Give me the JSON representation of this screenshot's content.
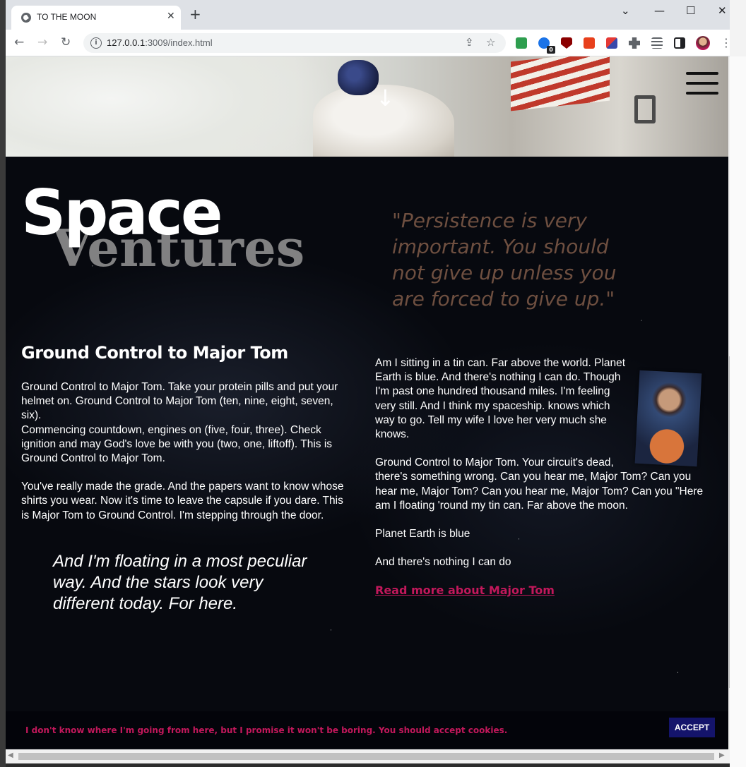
{
  "browser": {
    "tab_title": "TO THE MOON",
    "tab_close": "✕",
    "new_tab": "+",
    "url_host": "127.0.0.1",
    "url_rest": ":3009/index.html",
    "badge_count": "0",
    "win_min": "⌄",
    "win_minimize": "—",
    "win_restore": "☐",
    "win_close": "✕",
    "back": "←",
    "forward": "→",
    "reload": "↻",
    "share_icon": "⇪",
    "star_icon": "☆",
    "kebab": "⋮"
  },
  "hero": {
    "scroll_arrow": "↓"
  },
  "logo": {
    "line1": "Space",
    "line2": "Ventures"
  },
  "quote": "\"Persistence is very important. You should not give up unless you are forced to give up.\"",
  "article": {
    "title": "Ground Control to Major Tom",
    "left_p1": "Ground Control to Major Tom. Take your protein pills and put your helmet on. Ground Control to Major Tom (ten, nine, eight, seven, six).\nCommencing countdown, engines on (five, four, three). Check ignition and may God's love be with you (two, one, liftoff). This is Ground Control to Major Tom.",
    "left_p2": "You've really made the grade. And the papers want to know whose shirts you wear. Now it's time to leave the capsule if you dare. This is Major Tom to Ground Control. I'm stepping through the door.",
    "pull_quote": "And I'm floating in a most peculiar way. And the stars look very different today. For here.",
    "right_p1": "Am I sitting in a tin can. Far above the world. Planet Earth is blue. And there's nothing I can do. Though I'm past one hundred thousand miles. I'm feeling very still. And I think my spaceship. knows which way to go. Tell my wife I love her very much she knows.",
    "right_p2": "Ground Control to Major Tom. Your circuit's dead, there's something wrong. Can you hear me, Major Tom? Can you hear me, Major Tom? Can you hear me, Major Tom? Can you \"Here am I floating 'round my tin can. Far above the moon.",
    "right_p3": "Planet Earth is blue",
    "right_p4": "And there's nothing I can do",
    "read_more": "Read more about Major Tom"
  },
  "cookie": {
    "message": "I don't know where I'm going from here, but I promise it won't be boring. You should accept cookies.",
    "accept": "ACCEPT"
  },
  "colors": {
    "accent": "#c2185b",
    "quote": "#6e4f40",
    "accept_bg": "#14146b"
  }
}
